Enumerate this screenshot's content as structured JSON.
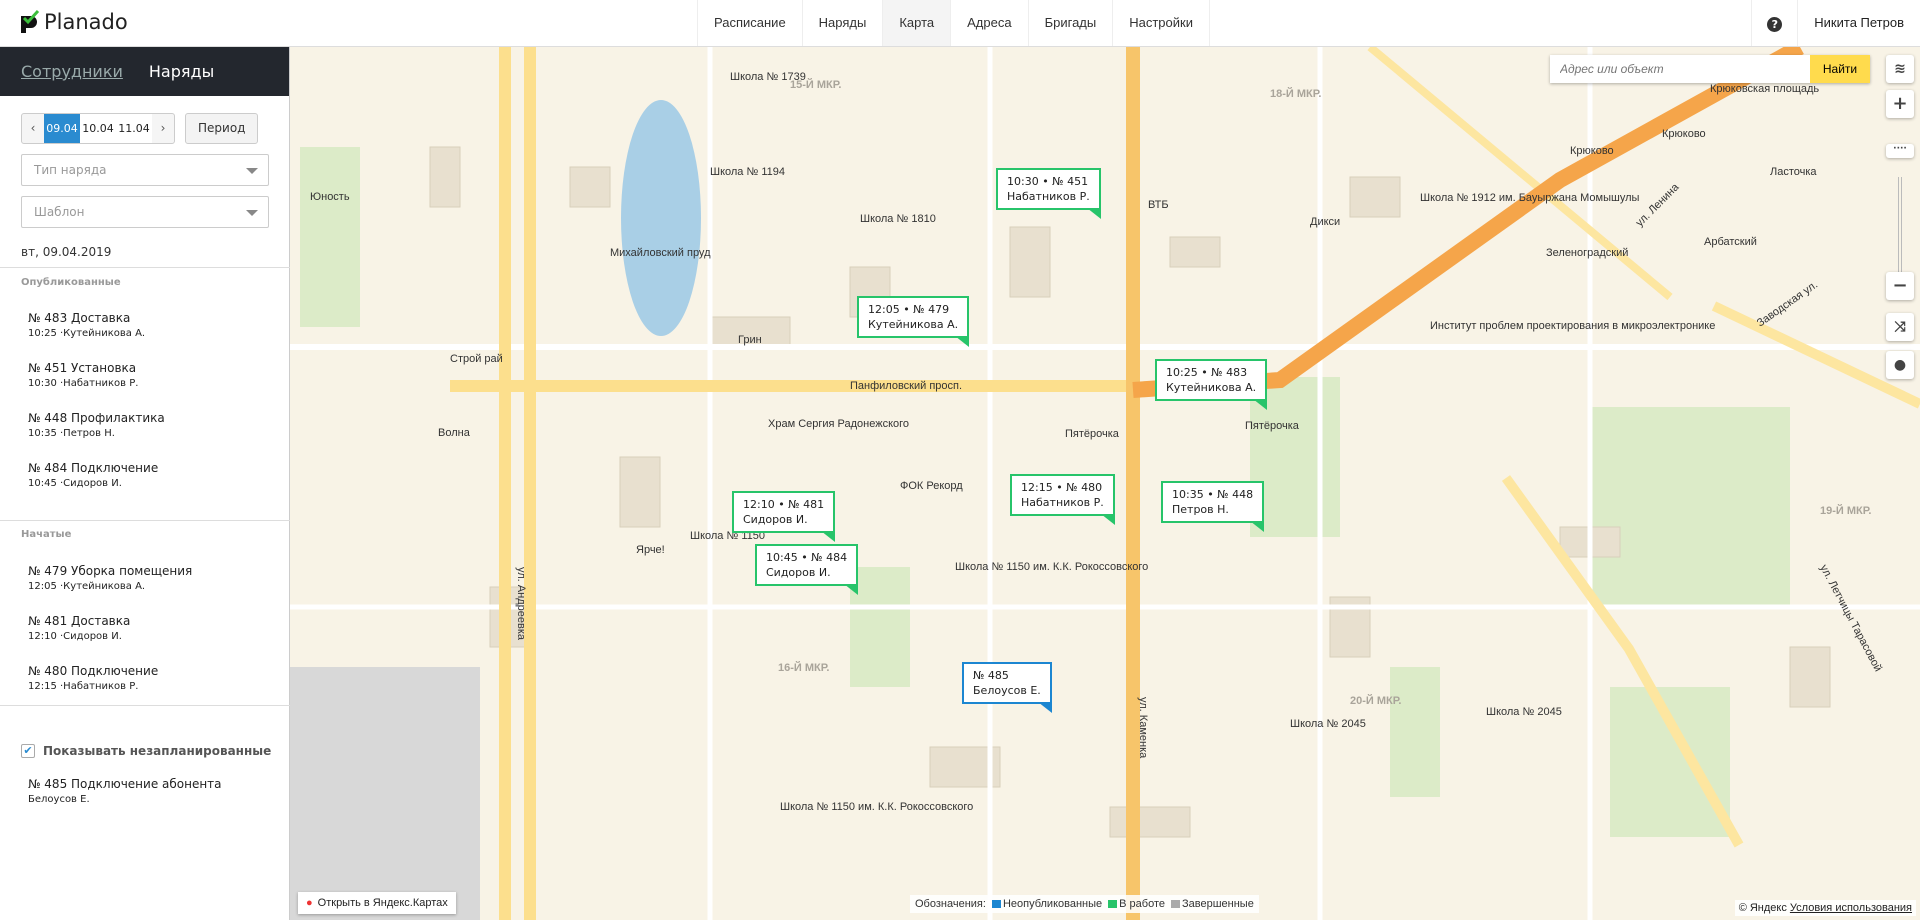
{
  "header": {
    "logo": "Planado",
    "nav": [
      "Расписание",
      "Наряды",
      "Карта",
      "Адреса",
      "Бригады",
      "Настройки"
    ],
    "active_nav": "Карта",
    "help": "?",
    "user": "Никита Петров"
  },
  "sidebar": {
    "tabs": {
      "employees": "Сотрудники",
      "orders": "Наряды"
    },
    "dates": [
      "09.04",
      "10.04",
      "11.04"
    ],
    "selected_date": "09.04",
    "period": "Период",
    "order_type_placeholder": "Тип наряда",
    "template_placeholder": "Шаблон",
    "day": "вт, 09.04.2019",
    "published_title": "Опубликованные",
    "published": [
      {
        "title": "№ 483 Доставка",
        "sub": "10:25 ·Кутейникова А."
      },
      {
        "title": "№ 451 Установка",
        "sub": "10:30 ·Набатников Р."
      },
      {
        "title": "№ 448 Профилактика",
        "sub": "10:35 ·Петров Н."
      },
      {
        "title": "№ 484 Подключение",
        "sub": "10:45 ·Сидоров И."
      }
    ],
    "started_title": "Начатые",
    "started": [
      {
        "title": "№ 479 Уборка помещения",
        "sub": "12:05 ·Кутейникова А."
      },
      {
        "title": "№ 481 Доставка",
        "sub": "12:10 ·Сидоров И."
      },
      {
        "title": "№ 480 Подключение",
        "sub": "12:15 ·Набатников Р."
      }
    ],
    "show_unplanned": "Показывать незапланированные",
    "show_unplanned_checked": true,
    "unplanned": [
      {
        "title": "№ 485 Подключение абонента",
        "sub": "Белоусов Е."
      }
    ]
  },
  "map": {
    "search_placeholder": "Адрес или объект",
    "search_button": "Найти",
    "markers": [
      {
        "l1": "10:30 • № 451",
        "l2": "Набатников Р.",
        "status": "in_progress"
      },
      {
        "l1": "12:05 • № 479",
        "l2": "Кутейникова А.",
        "status": "in_progress"
      },
      {
        "l1": "10:25 • № 483",
        "l2": "Кутейникова А.",
        "status": "in_progress"
      },
      {
        "l1": "12:10 • № 481",
        "l2": "Сидоров И.",
        "status": "in_progress"
      },
      {
        "l1": "10:45 • № 484",
        "l2": "Сидоров И.",
        "status": "in_progress"
      },
      {
        "l1": "12:15 • № 480",
        "l2": "Набатников Р.",
        "status": "in_progress"
      },
      {
        "l1": "10:35 • № 448",
        "l2": "Петров Н.",
        "status": "in_progress"
      },
      {
        "l1": "№ 485",
        "l2": "Белоусов Е.",
        "status": "unpublished"
      }
    ],
    "labels": [
      "Школа № 1739",
      "15-Й МКР.",
      "Школа № 1194",
      "Школа № 1810",
      "Михайловский пруд",
      "Грин",
      "Юность",
      "Строй рай",
      "Волна",
      "Панфиловский просп.",
      "Храм Сергия Радонежского",
      "ФОК Рекорд",
      "Пятёрочка",
      "Пятёрочка",
      "Школа № 1150",
      "Ярче!",
      "Школа № 1150 им. К.К. Рокоссовского",
      "16-Й МКР.",
      "20-Й МКР.",
      "Школа № 2045",
      "Школа № 2045",
      "Школа № 1150 им. К.К. Рокоссовского",
      "ВТБ",
      "Дикси",
      "18-Й МКР.",
      "Школа № 1912 им. Бауыржана Момышулы",
      "Крюково",
      "Крюково",
      "Ласточка",
      "Арбатский",
      "Зеленоградский",
      "Институт проблем проектирования в микроэлектронике",
      "19-Й МКР.",
      "Крюковская площадь",
      "ул. Андреевка",
      "ул. Каменка",
      "ул. Ленина",
      "Заводская ул.",
      "ул. Летчицы Тарасовой"
    ],
    "open_yandex": "Открыть в Яндекс.Картах",
    "legend": {
      "title": "Обозначения:",
      "unpublished": "Неопубликованные",
      "in_progress": "В работе",
      "done": "Завершенные"
    },
    "copyright": "© Яндекс",
    "terms": "Условия использования",
    "colors": {
      "in_progress": "#27c46a",
      "unpublished": "#1c86d1",
      "done": "#aaaaaa",
      "search": "#ffdb4d"
    }
  }
}
